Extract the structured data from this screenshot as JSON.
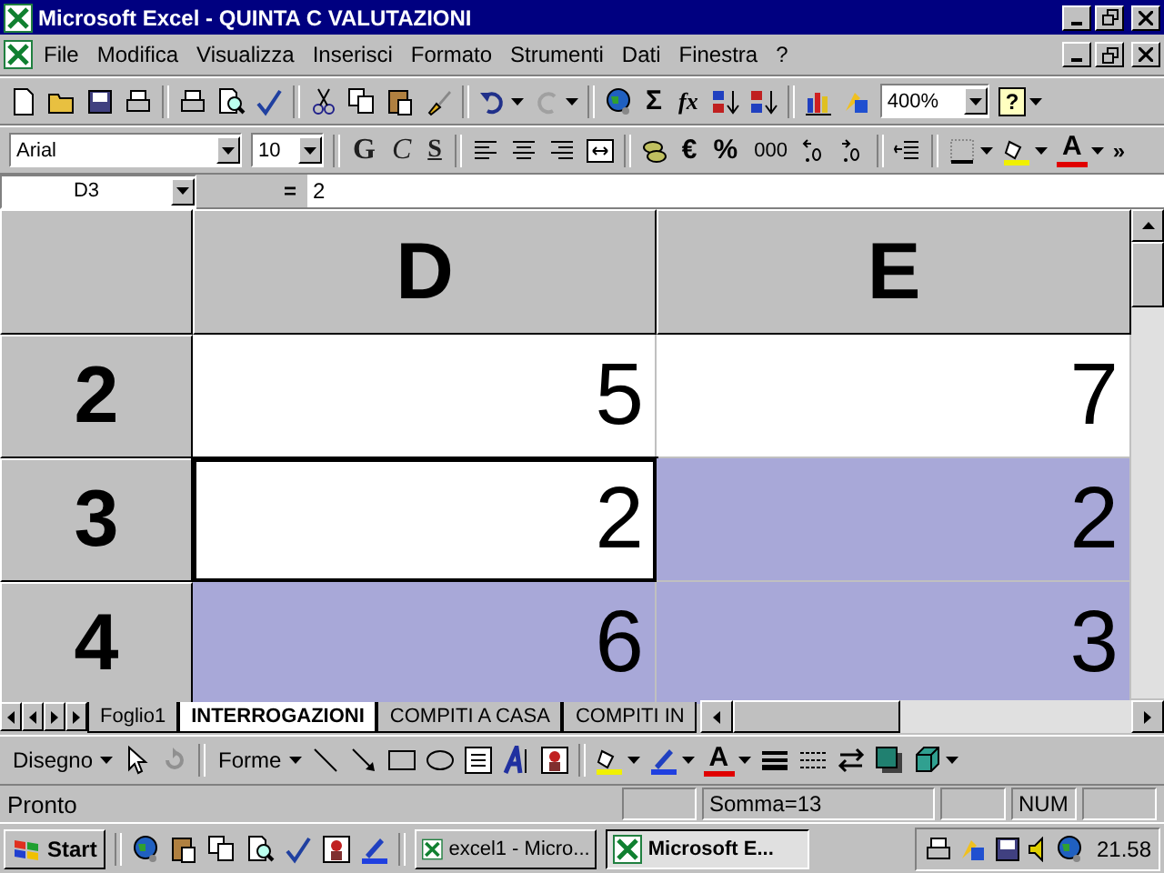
{
  "window": {
    "title": "Microsoft Excel - QUINTA C VALUTAZIONI"
  },
  "menu": [
    "File",
    "Modifica",
    "Visualizza",
    "Inserisci",
    "Formato",
    "Strumenti",
    "Dati",
    "Finestra",
    "?"
  ],
  "standard_toolbar": {
    "sum": "Σ",
    "function": "fx",
    "zoom": "400%",
    "help": "?"
  },
  "formatting_toolbar": {
    "font": "Arial",
    "size": "10",
    "bold": "G",
    "italic": "C",
    "underline": "S",
    "euro": "€",
    "percent": "%",
    "thousands": "000",
    "font_color": "A",
    "more": "»"
  },
  "formula_bar": {
    "name_box": "D3",
    "equals": "=",
    "value": "2"
  },
  "columns": [
    "D",
    "E"
  ],
  "rows": [
    {
      "header": "2",
      "cells": [
        {
          "value": "5",
          "selected": false,
          "active": false
        },
        {
          "value": "7",
          "selected": false,
          "active": false
        }
      ]
    },
    {
      "header": "3",
      "cells": [
        {
          "value": "2",
          "selected": false,
          "active": true
        },
        {
          "value": "2",
          "selected": true,
          "active": false
        }
      ]
    },
    {
      "header": "4",
      "cells": [
        {
          "value": "6",
          "selected": true,
          "active": false
        },
        {
          "value": "3",
          "selected": true,
          "active": false
        }
      ]
    }
  ],
  "sheet_tabs": [
    {
      "label": "Foglio1",
      "selected": false
    },
    {
      "label": "INTERROGAZIONI",
      "selected": true
    },
    {
      "label": "COMPITI A CASA",
      "selected": false
    },
    {
      "label": "COMPITI IN",
      "selected": false
    }
  ],
  "drawing_toolbar": {
    "draw_menu": "Disegno",
    "shapes_menu": "Forme",
    "font_color": "A"
  },
  "status_bar": {
    "status": "Pronto",
    "sum": "Somma=13",
    "num": "NUM"
  },
  "taskbar": {
    "start": "Start",
    "tasks": [
      {
        "label": "excel1 - Micro...",
        "selected": false
      },
      {
        "label": "Microsoft E...",
        "selected": true
      }
    ],
    "clock": "21.58"
  }
}
